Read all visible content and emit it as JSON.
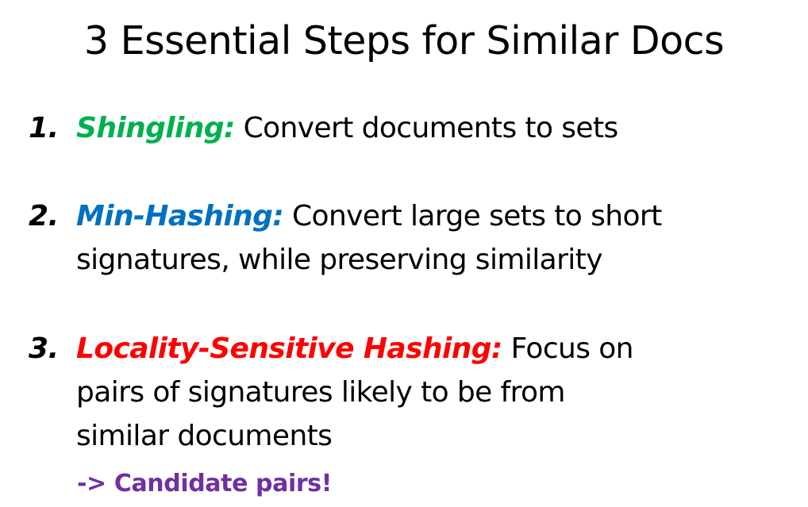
{
  "title": "3 Essential Steps for Similar Docs",
  "colors": {
    "shingling": "#00B050",
    "minhashing": "#0070C0",
    "lsh": "#FF0000",
    "candidate": "#7030A0"
  },
  "steps": [
    {
      "number": "1.",
      "term": "Shingling:",
      "lines": [
        " Convert documents to sets"
      ]
    },
    {
      "number": "2.",
      "term": "Min-Hashing:",
      "lines": [
        " Convert large sets to short",
        "signatures, while preserving similarity"
      ]
    },
    {
      "number": "3.",
      "term": "Locality-Sensitive Hashing:",
      "lines": [
        " Focus on",
        "pairs of signatures likely to be from",
        "similar documents"
      ]
    }
  ],
  "candidate_note": "-> Candidate pairs!"
}
